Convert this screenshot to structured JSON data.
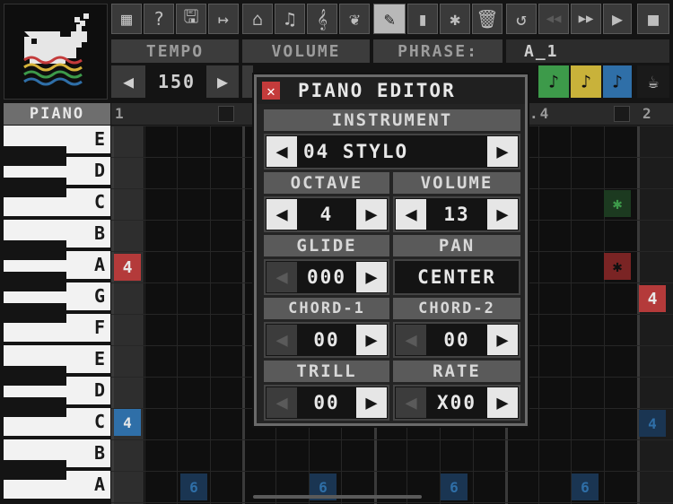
{
  "toolbar": {
    "icons": [
      "grid-icon",
      "help-icon",
      "save-icon",
      "export-icon",
      "piano-icon",
      "note-icon",
      "clef-icon",
      "bird-icon",
      "pencil-icon",
      "eraser-icon",
      "star-icon",
      "trash-icon",
      "undo-icon",
      "rewind-icon",
      "fast-forward-icon",
      "play-icon",
      "stop-icon"
    ],
    "glyphs": [
      "▦",
      "?",
      "🖫",
      "↦",
      "⌂",
      "♫",
      "𝄞",
      "❦",
      "✎",
      "▮",
      "✱",
      "🗑",
      "↺",
      "◀◀",
      "▶▶",
      "▶",
      "■"
    ]
  },
  "header": {
    "tempo_label": "TEMPO",
    "volume_label": "VOLUME",
    "phrase_label": "PHRASE:",
    "phrase_value": "A_1",
    "tempo_value": "150",
    "left_arrow": "◀",
    "right_arrow": "▶"
  },
  "track_buttons": [
    "♪",
    "♪",
    "♪"
  ],
  "piano": {
    "label": "PIANO",
    "keys": [
      "E",
      "D",
      "C",
      "B",
      "A",
      "G",
      "F",
      "E",
      "D",
      "C",
      "B",
      "A"
    ]
  },
  "grid": {
    "column_1": "1",
    "column_1_4": ".4",
    "column_2": "2"
  },
  "editor": {
    "title": "PIANO EDITOR",
    "close_glyph": "✕",
    "instrument_label": "INSTRUMENT",
    "instrument_value": "04 STYLO",
    "octave_label": "OCTAVE",
    "octave_value": "4",
    "volume_label": "VOLUME",
    "volume_value": "13",
    "glide_label": "GLIDE",
    "glide_value": "000",
    "pan_label": "PAN",
    "pan_value": "CENTER",
    "chord1_label": "CHORD-1",
    "chord1_value": "00",
    "chord2_label": "CHORD-2",
    "chord2_value": "00",
    "trill_label": "TRILL",
    "trill_value": "00",
    "rate_label": "RATE",
    "rate_value": "x00",
    "left_arrow": "◀",
    "right_arrow": "▶"
  },
  "notes": {
    "a_note": "4",
    "c_note": "4",
    "bottom_note": "6",
    "star": "✱"
  },
  "colors": {
    "note_red": "#b43a3a",
    "note_blue": "#2f6fa8",
    "note_green": "#3d9a4a",
    "track_yellow": "#c9b23a"
  }
}
